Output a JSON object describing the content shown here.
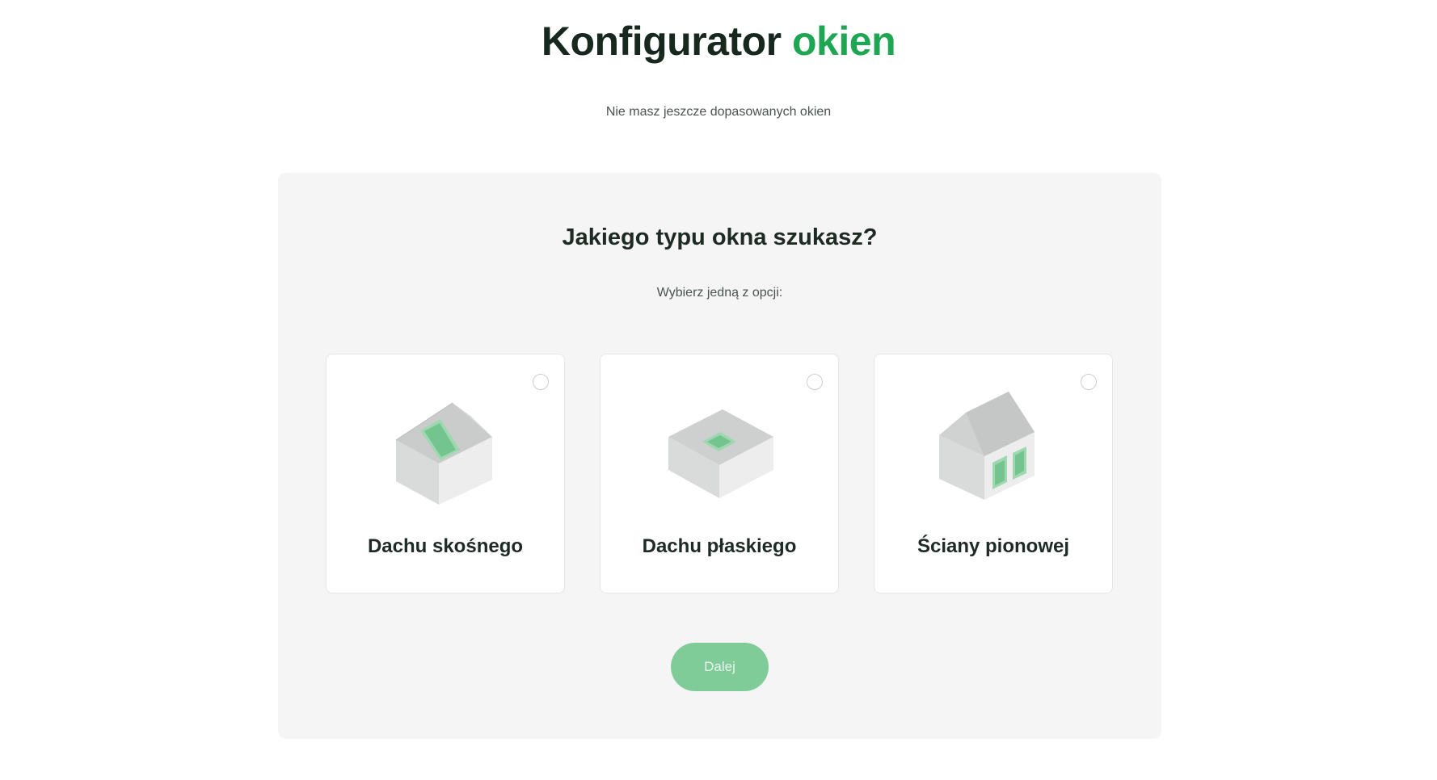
{
  "header": {
    "title_main": "Konfigurator",
    "title_accent": "okien",
    "subtitle": "Nie masz jeszcze dopasowanych okien"
  },
  "question": {
    "title": "Jakiego typu okna szukasz?",
    "hint": "Wybierz jedną z opcji:"
  },
  "options": [
    {
      "label": "Dachu skośnego",
      "icon": "pitched-roof-house-icon",
      "selected": false
    },
    {
      "label": "Dachu płaskiego",
      "icon": "flat-roof-house-icon",
      "selected": false
    },
    {
      "label": "Ściany pionowej",
      "icon": "vertical-wall-house-icon",
      "selected": false
    }
  ],
  "actions": {
    "next_label": "Dalej"
  },
  "colors": {
    "accent": "#1fa653",
    "button_disabled": "#7fcc99",
    "panel_bg": "#f4f5f4"
  }
}
